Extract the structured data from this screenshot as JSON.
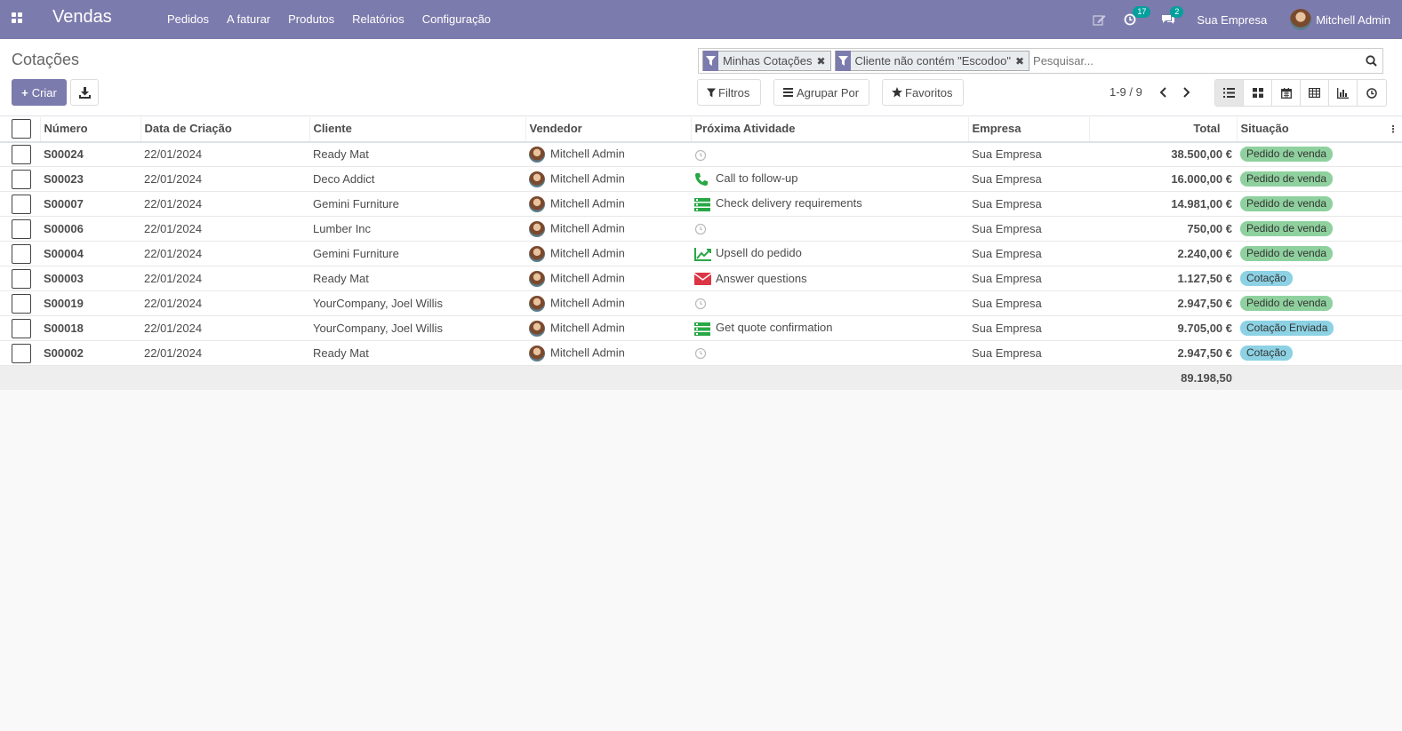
{
  "navbar": {
    "app_name": "Vendas",
    "menu": [
      "Pedidos",
      "A faturar",
      "Produtos",
      "Relatórios",
      "Configuração"
    ],
    "activity_count": "17",
    "message_count": "2",
    "company": "Sua Empresa",
    "user": "Mitchell Admin"
  },
  "control_panel": {
    "breadcrumb": "Cotações",
    "create_label": "Criar",
    "facets": [
      "Minhas Cotações",
      "Cliente não contém \"Escodoo\""
    ],
    "search_placeholder": "Pesquisar...",
    "filters_label": "Filtros",
    "groupby_label": "Agrupar Por",
    "favorites_label": "Favoritos",
    "pager": "1-9 / 9",
    "views": [
      "list-view-icon",
      "kanban-view-icon",
      "calendar-view-icon",
      "pivot-view-icon",
      "graph-view-icon",
      "activity-view-icon"
    ],
    "active_view": "list-view-icon"
  },
  "table": {
    "columns": [
      "Número",
      "Data de Criação",
      "Cliente",
      "Vendedor",
      "Próxima Atividade",
      "Empresa",
      "Total",
      "Situação"
    ],
    "rows": [
      {
        "number": "S00024",
        "date": "22/01/2024",
        "customer": "Ready Mat",
        "salesperson": "Mitchell Admin",
        "activity_icon": "clock-icon",
        "activity": "",
        "company": "Sua Empresa",
        "total": "38.500,00 €",
        "status": "Pedido de venda"
      },
      {
        "number": "S00023",
        "date": "22/01/2024",
        "customer": "Deco Addict",
        "salesperson": "Mitchell Admin",
        "activity_icon": "phone-icon",
        "activity": "Call to follow-up",
        "company": "Sua Empresa",
        "total": "16.000,00 €",
        "status": "Pedido de venda"
      },
      {
        "number": "S00007",
        "date": "22/01/2024",
        "customer": "Gemini Furniture",
        "salesperson": "Mitchell Admin",
        "activity_icon": "tasks-icon",
        "activity": "Check delivery requirements",
        "company": "Sua Empresa",
        "total": "14.981,00 €",
        "status": "Pedido de venda"
      },
      {
        "number": "S00006",
        "date": "22/01/2024",
        "customer": "Lumber Inc",
        "salesperson": "Mitchell Admin",
        "activity_icon": "clock-icon",
        "activity": "",
        "company": "Sua Empresa",
        "total": "750,00 €",
        "status": "Pedido de venda"
      },
      {
        "number": "S00004",
        "date": "22/01/2024",
        "customer": "Gemini Furniture",
        "salesperson": "Mitchell Admin",
        "activity_icon": "line-chart-icon",
        "activity": "Upsell do pedido",
        "company": "Sua Empresa",
        "total": "2.240,00 €",
        "status": "Pedido de venda"
      },
      {
        "number": "S00003",
        "date": "22/01/2024",
        "customer": "Ready Mat",
        "salesperson": "Mitchell Admin",
        "activity_icon": "envelope-icon",
        "activity": "Answer questions",
        "company": "Sua Empresa",
        "total": "1.127,50 €",
        "status": "Cotação"
      },
      {
        "number": "S00019",
        "date": "22/01/2024",
        "customer": "YourCompany, Joel Willis",
        "salesperson": "Mitchell Admin",
        "activity_icon": "clock-icon",
        "activity": "",
        "company": "Sua Empresa",
        "total": "2.947,50 €",
        "status": "Pedido de venda"
      },
      {
        "number": "S00018",
        "date": "22/01/2024",
        "customer": "YourCompany, Joel Willis",
        "salesperson": "Mitchell Admin",
        "activity_icon": "tasks-icon",
        "activity": "Get quote confirmation",
        "company": "Sua Empresa",
        "total": "9.705,00 €",
        "status": "Cotação Enviada"
      },
      {
        "number": "S00002",
        "date": "22/01/2024",
        "customer": "Ready Mat",
        "salesperson": "Mitchell Admin",
        "activity_icon": "clock-icon",
        "activity": "",
        "company": "Sua Empresa",
        "total": "2.947,50 €",
        "status": "Cotação"
      }
    ],
    "grand_total": "89.198,50"
  },
  "colors": {
    "brand": "#7c7bad",
    "status_sale": "#8fd19e",
    "status_quote": "#8cd2e4",
    "activity_green": "#28a745",
    "activity_red": "#dc3545",
    "activity_muted": "#bbbbbb"
  }
}
